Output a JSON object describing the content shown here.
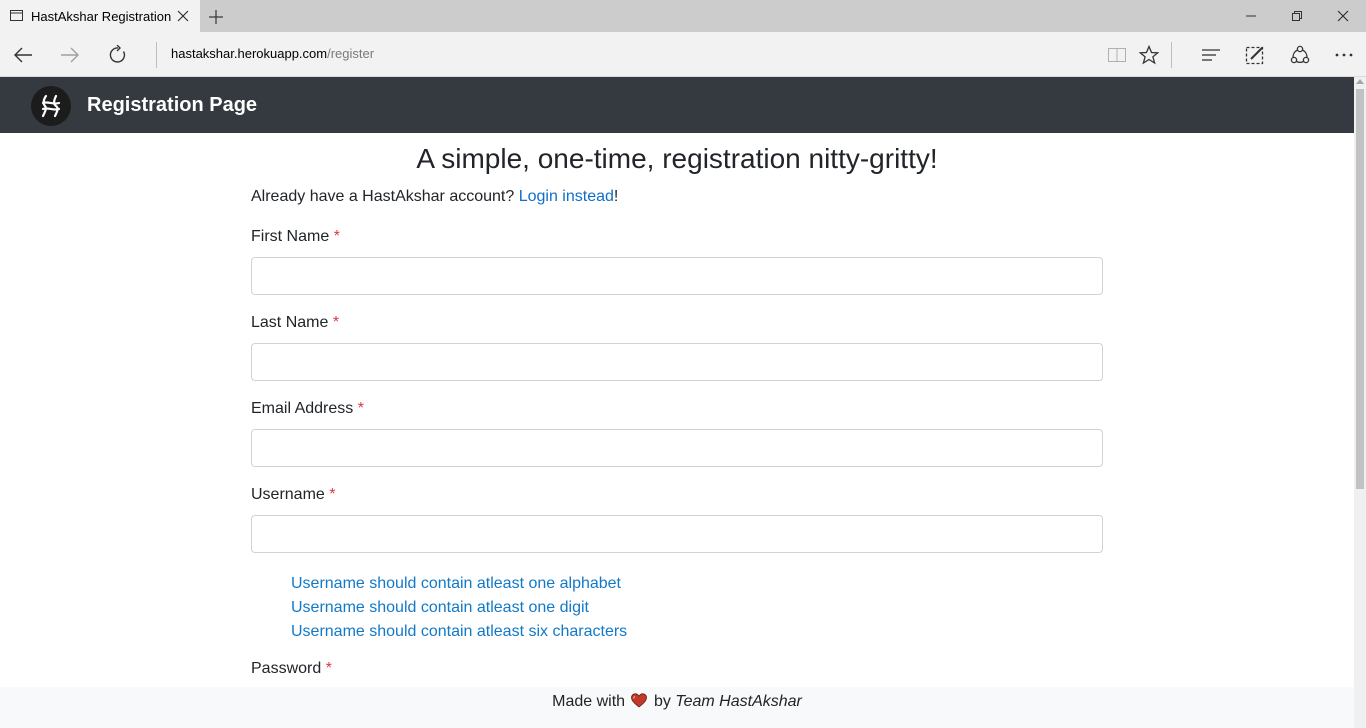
{
  "browser": {
    "tab_title": "HastAkshar Registration",
    "address_domain": "hastakshar.herokuapp.com",
    "address_path": "/register",
    "icons": [
      "tab-page-icon",
      "close-icon",
      "plus-icon",
      "minimize-icon",
      "restore-icon",
      "close-window-icon",
      "back-icon",
      "forward-icon",
      "refresh-icon",
      "reading-view-icon",
      "favorite-star-icon",
      "hub-icon",
      "web-note-icon",
      "share-icon",
      "more-icon"
    ]
  },
  "header": {
    "title": "Registration Page",
    "logo_icon": "hastakshar-logo-icon",
    "background": "#343a40"
  },
  "page": {
    "headline": "A simple, one-time, registration nitty-gritty!",
    "already_prefix": "Already have a HastAkshar account? ",
    "login_link": "Login instead",
    "already_suffix": "!",
    "required_mark": "*",
    "link_color": "#0f6ec9"
  },
  "form": {
    "first_name": {
      "label": "First Name",
      "value": ""
    },
    "last_name": {
      "label": "Last Name",
      "value": ""
    },
    "email": {
      "label": "Email Address",
      "value": ""
    },
    "username": {
      "label": "Username",
      "value": ""
    },
    "password": {
      "label": "Password"
    },
    "username_hints": [
      "Username should contain atleast one alphabet",
      "Username should contain atleast one digit",
      "Username should contain atleast six characters"
    ]
  },
  "footer": {
    "prefix": "Made with",
    "middle": "by",
    "team": "Team HastAkshar",
    "heart_icon": "heart-icon",
    "heart_color": "#c0392b"
  }
}
